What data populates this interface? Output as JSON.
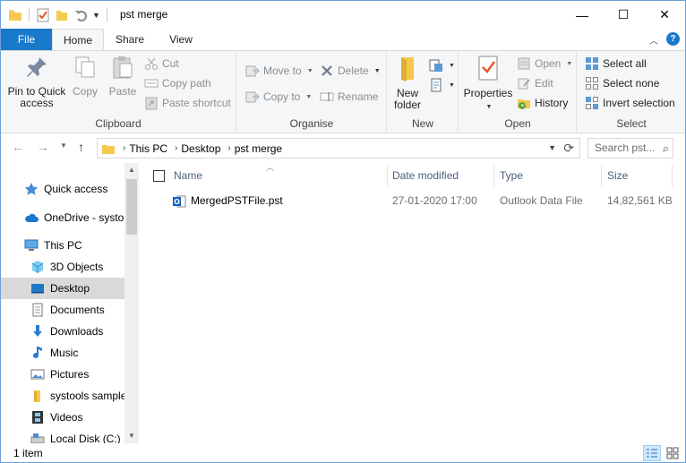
{
  "window": {
    "title": "pst merge",
    "minimize": "—",
    "maximize": "☐",
    "close": "✕"
  },
  "tabs": [
    {
      "label": "File"
    },
    {
      "label": "Home"
    },
    {
      "label": "Share"
    },
    {
      "label": "View"
    }
  ],
  "ribbon": {
    "clipboard": {
      "label": "Clipboard",
      "pin": "Pin to Quick access",
      "copy": "Copy",
      "paste": "Paste",
      "cut": "Cut",
      "copy_path": "Copy path",
      "paste_shortcut": "Paste shortcut"
    },
    "organise": {
      "label": "Organise",
      "move_to": "Move to",
      "copy_to": "Copy to",
      "delete": "Delete",
      "rename": "Rename"
    },
    "new": {
      "label": "New",
      "new_folder": "New folder"
    },
    "open": {
      "label": "Open",
      "properties": "Properties",
      "open": "Open",
      "edit": "Edit",
      "history": "History"
    },
    "select": {
      "label": "Select",
      "select_all": "Select all",
      "select_none": "Select none",
      "invert": "Invert selection"
    }
  },
  "address": {
    "crumbs": [
      "This PC",
      "Desktop",
      "pst merge"
    ],
    "search_placeholder": "Search pst..."
  },
  "nav": {
    "items": [
      {
        "label": "Quick access"
      },
      {
        "label": "OneDrive - systoo"
      },
      {
        "label": "This PC"
      },
      {
        "label": "3D Objects"
      },
      {
        "label": "Desktop"
      },
      {
        "label": "Documents"
      },
      {
        "label": "Downloads"
      },
      {
        "label": "Music"
      },
      {
        "label": "Pictures"
      },
      {
        "label": "systools sample"
      },
      {
        "label": "Videos"
      },
      {
        "label": "Local Disk (C:)"
      }
    ]
  },
  "files": {
    "columns": [
      "Name",
      "Date modified",
      "Type",
      "Size"
    ],
    "rows": [
      {
        "name": "MergedPSTFile.pst",
        "date": "27-01-2020 17:00",
        "type": "Outlook Data File",
        "size": "14,82,561 KB"
      }
    ]
  },
  "status": {
    "count": "1 item"
  },
  "colors": {
    "file_tab": "#1979ca",
    "selected_nav": "#d9d9d9",
    "header_text": "#4c607a"
  }
}
